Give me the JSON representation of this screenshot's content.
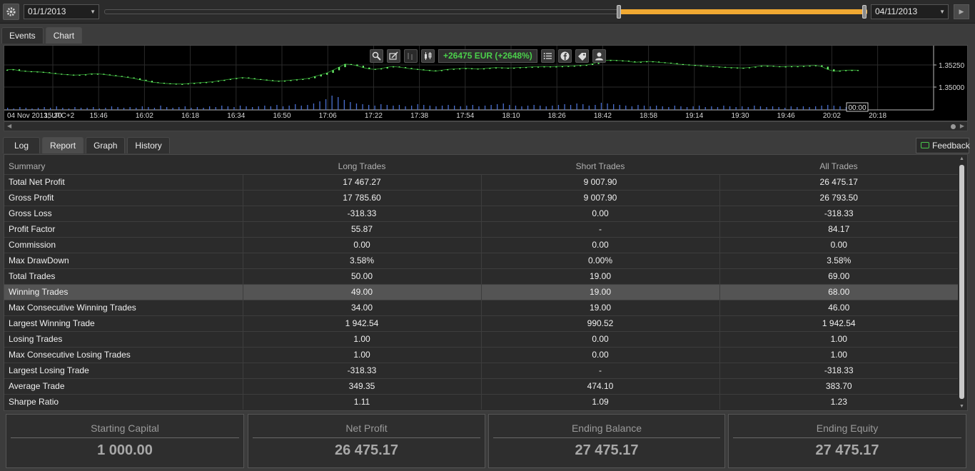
{
  "timeline": {
    "start_date": "01/1/2013",
    "end_date": "04/11/2013",
    "selection_start": 0.676,
    "selection_end": 1.0
  },
  "top_tabs": [
    {
      "label": "Events",
      "active": false
    },
    {
      "label": "Chart",
      "active": true
    }
  ],
  "chart": {
    "pnl_text": "+26475 EUR (+2648%)",
    "pnl_color": "#4bd04b",
    "x_ticks": [
      "04 Nov 2013, UTC+2",
      "15:30",
      "15:46",
      "16:02",
      "16:18",
      "16:34",
      "16:50",
      "17:06",
      "17:22",
      "17:38",
      "17:54",
      "18:10",
      "18:26",
      "18:42",
      "18:58",
      "19:14",
      "19:30",
      "19:46",
      "20:02",
      "20:18"
    ],
    "y_ticks": [
      "1.35250",
      "1.35000"
    ],
    "countdown": "00:00",
    "toolbar_icons": [
      "zoom-icon",
      "drawing-icon",
      "bar-chart-icon",
      "candlestick-icon",
      "list-icon",
      "facebook-icon",
      "tag-icon",
      "user-icon"
    ],
    "price_series": [
      1.35195,
      1.352,
      1.35185,
      1.35178,
      1.35175,
      1.35172,
      1.35168,
      1.3516,
      1.3515,
      1.35145,
      1.3514,
      1.35135,
      1.35138,
      1.35142,
      1.3515,
      1.3515,
      1.35143,
      1.35135,
      1.35125,
      1.35118,
      1.35108,
      1.35098,
      1.35082,
      1.3507,
      1.35055,
      1.35048,
      1.35042,
      1.35038,
      1.35035,
      1.35035,
      1.3504,
      1.35045,
      1.3505,
      1.35055,
      1.3506,
      1.3507,
      1.3508,
      1.3509,
      1.351,
      1.35108,
      1.351,
      1.3509,
      1.35085,
      1.35078,
      1.3507,
      1.35068,
      1.35072,
      1.35078,
      1.35085,
      1.3509,
      1.351,
      1.3512,
      1.3514,
      1.3516,
      1.3519,
      1.35225,
      1.3526,
      1.35255,
      1.3524,
      1.3522,
      1.35205,
      1.352,
      1.3521,
      1.35225,
      1.35232,
      1.35225,
      1.35215,
      1.35205,
      1.352,
      1.35192,
      1.35188,
      1.3518,
      1.3519,
      1.352,
      1.35205,
      1.3521,
      1.35212,
      1.35208,
      1.35205,
      1.3521,
      1.35215,
      1.3522,
      1.35218,
      1.35215,
      1.35218,
      1.35222,
      1.35225,
      1.35228,
      1.3523,
      1.35232,
      1.3523,
      1.35232,
      1.35235,
      1.35238,
      1.3524,
      1.35245,
      1.3525,
      1.35262,
      1.35285,
      1.353,
      1.35305,
      1.353,
      1.35298,
      1.3529,
      1.3528,
      1.35285,
      1.3529,
      1.35288,
      1.3528,
      1.35275,
      1.3527,
      1.3526,
      1.35255,
      1.3525,
      1.35245,
      1.3524,
      1.35235,
      1.3523,
      1.35228,
      1.35222,
      1.3522,
      1.35218,
      1.35215,
      1.35222,
      1.3523,
      1.3524,
      1.3524,
      1.35235,
      1.3523,
      1.35232,
      1.35235,
      1.35235,
      1.35238,
      1.35242,
      1.35245,
      1.3523,
      1.352,
      1.35178,
      1.35185,
      1.3519,
      1.35192,
      1.3519
    ],
    "volume_series": [
      3,
      2,
      4,
      3,
      2,
      3,
      4,
      3,
      5,
      3,
      2,
      4,
      3,
      3,
      4,
      2,
      3,
      5,
      4,
      3,
      4,
      3,
      5,
      4,
      3,
      6,
      4,
      3,
      4,
      5,
      3,
      4,
      3,
      5,
      4,
      6,
      5,
      4,
      6,
      5,
      4,
      5,
      6,
      5,
      7,
      5,
      6,
      8,
      6,
      7,
      9,
      12,
      15,
      20,
      18,
      14,
      11,
      9,
      8,
      7,
      6,
      8,
      7,
      6,
      7,
      5,
      6,
      8,
      7,
      6,
      5,
      6,
      7,
      6,
      5,
      6,
      7,
      5,
      6,
      7,
      8,
      9,
      7,
      6,
      5,
      6,
      7,
      6,
      5,
      6,
      7,
      8,
      7,
      9,
      8,
      6,
      7,
      10,
      9,
      8,
      7,
      6,
      5,
      7,
      6,
      5,
      6,
      5,
      4,
      6,
      5,
      4,
      5,
      6,
      4,
      5,
      4,
      6,
      5,
      4,
      5,
      4,
      6,
      5,
      4,
      5,
      4,
      3,
      5,
      4,
      5,
      4,
      5,
      6,
      7,
      6,
      5,
      4,
      3,
      2
    ]
  },
  "bottom_tabs": [
    {
      "label": "Log",
      "active": false
    },
    {
      "label": "Report",
      "active": true
    },
    {
      "label": "Graph",
      "active": false
    },
    {
      "label": "History",
      "active": false
    }
  ],
  "feedback_label": "Feedback",
  "report": {
    "headers": [
      "Summary",
      "Long Trades",
      "Short Trades",
      "All Trades"
    ],
    "rows": [
      [
        "Total Net Profit",
        "17 467.27",
        "9 007.90",
        "26 475.17"
      ],
      [
        "Gross Profit",
        "17 785.60",
        "9 007.90",
        "26 793.50"
      ],
      [
        "Gross Loss",
        "-318.33",
        "0.00",
        "-318.33"
      ],
      [
        "Profit Factor",
        "55.87",
        "-",
        "84.17"
      ],
      [
        "Commission",
        "0.00",
        "0.00",
        "0.00"
      ],
      [
        "Max DrawDown",
        "3.58%",
        "0.00%",
        "3.58%"
      ],
      [
        "Total Trades",
        "50.00",
        "19.00",
        "69.00"
      ],
      [
        "Winning Trades",
        "49.00",
        "19.00",
        "68.00"
      ],
      [
        "Max Consecutive Winning Trades",
        "34.00",
        "19.00",
        "46.00"
      ],
      [
        "Largest Winning Trade",
        "1 942.54",
        "990.52",
        "1 942.54"
      ],
      [
        "Losing Trades",
        "1.00",
        "0.00",
        "1.00"
      ],
      [
        "Max Consecutive Losing Trades",
        "1.00",
        "0.00",
        "1.00"
      ],
      [
        "Largest Losing Trade",
        "-318.33",
        "-",
        "-318.33"
      ],
      [
        "Average Trade",
        "349.35",
        "474.10",
        "383.70"
      ],
      [
        "Sharpe Ratio",
        "1.11",
        "1.09",
        "1.23"
      ]
    ],
    "highlighted_row": 7
  },
  "summary_cards": [
    {
      "label": "Starting Capital",
      "value": "1 000.00"
    },
    {
      "label": "Net Profit",
      "value": "26 475.17"
    },
    {
      "label": "Ending Balance",
      "value": "27 475.17"
    },
    {
      "label": "Ending Equity",
      "value": "27 475.17"
    }
  ]
}
